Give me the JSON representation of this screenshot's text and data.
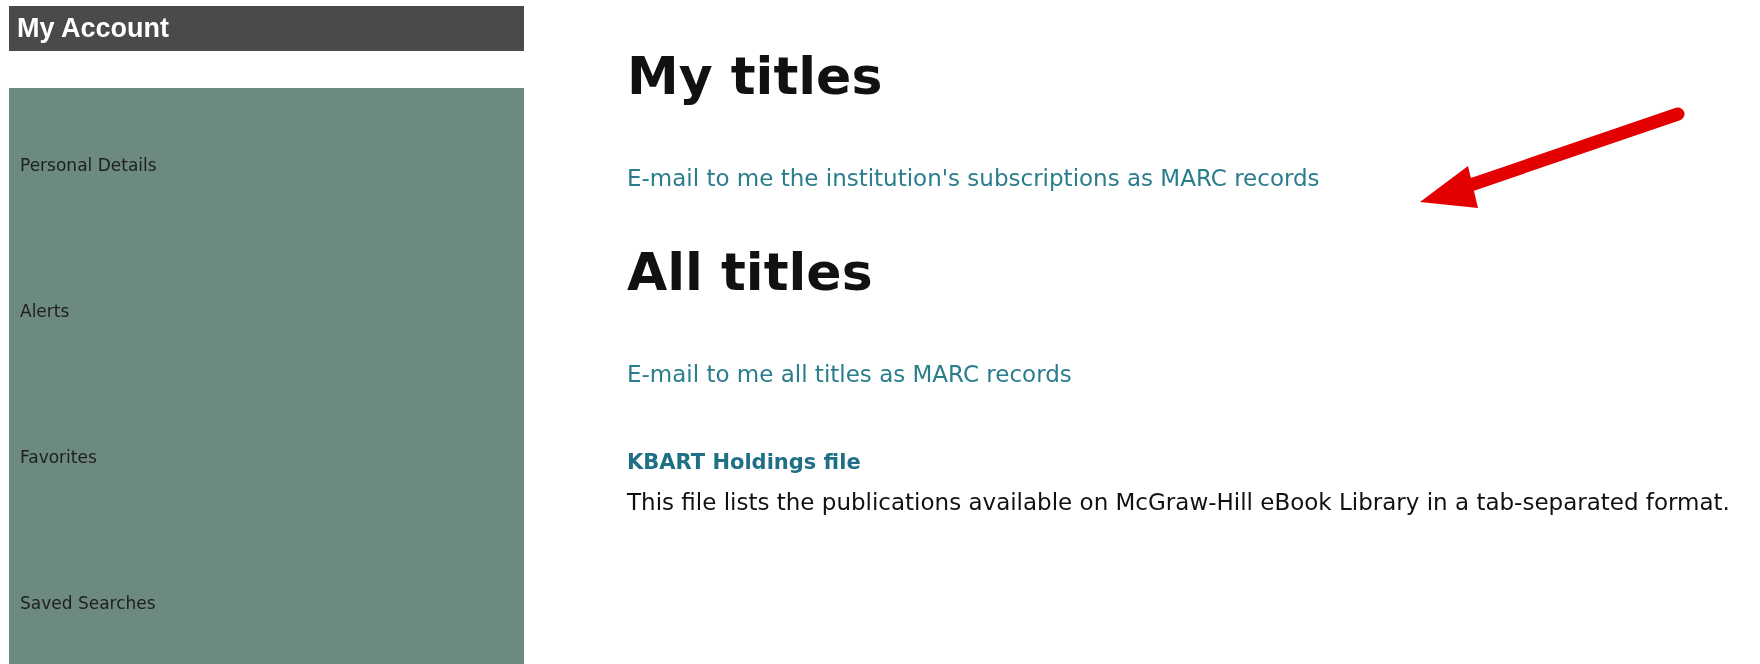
{
  "sidebar": {
    "title": "My Account",
    "items": [
      {
        "label": "Personal Details"
      },
      {
        "label": "Alerts"
      },
      {
        "label": "Favorites"
      },
      {
        "label": "Saved Searches"
      }
    ]
  },
  "sections": [
    {
      "heading": "My titles",
      "links": [
        "E-mail to me the institution's subscriptions as MARC records"
      ]
    },
    {
      "heading": "All titles",
      "links": [
        "E-mail to me all titles as MARC records"
      ]
    }
  ],
  "kbart": {
    "title": "KBART Holdings file",
    "description": "This file lists the publications available on McGraw-Hill eBook Library in a tab-separated format."
  }
}
